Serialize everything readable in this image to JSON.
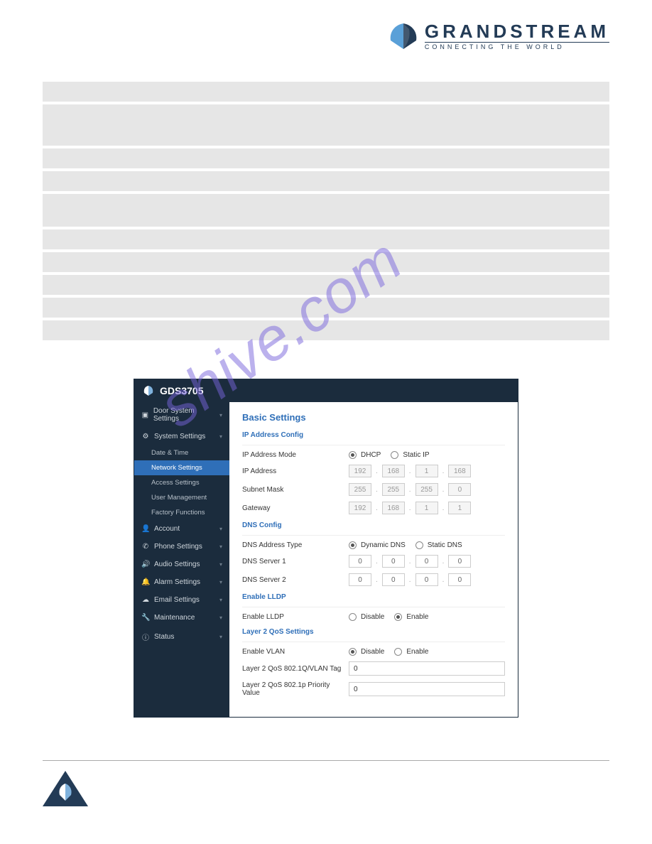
{
  "brand": {
    "name": "GRANDSTREAM",
    "tagline": "CONNECTING THE WORLD"
  },
  "settings_rows": [
    {
      "label": "",
      "desc": "",
      "h": "h-small"
    },
    {
      "label": "",
      "desc": "",
      "h": "h-med"
    },
    {
      "label": "",
      "desc": "",
      "h": "h-small"
    },
    {
      "label": "",
      "desc": "",
      "h": "h-small"
    },
    {
      "label": "",
      "desc": "",
      "h": "h-tall"
    },
    {
      "label": "",
      "desc": "",
      "h": "h-small"
    },
    {
      "label": "",
      "desc": "",
      "h": "h-small"
    },
    {
      "label": "",
      "desc": "",
      "h": "h-small"
    },
    {
      "label": "",
      "desc": "",
      "h": "h-small"
    },
    {
      "label": "",
      "desc": "",
      "h": "h-small"
    }
  ],
  "section": {
    "heading": "",
    "desc": ""
  },
  "watermark": "shive.com",
  "panel": {
    "title": "GDS3705",
    "sidebar": {
      "door": {
        "label": "Door System Settings"
      },
      "system": {
        "label": "System Settings",
        "children": {
          "datetime": "Date & Time",
          "network": "Network Settings",
          "access": "Access Settings",
          "usermgmt": "User Management",
          "factory": "Factory Functions"
        }
      },
      "account": {
        "label": "Account"
      },
      "phone": {
        "label": "Phone Settings"
      },
      "audio": {
        "label": "Audio Settings"
      },
      "alarm": {
        "label": "Alarm Settings"
      },
      "email": {
        "label": "Email Settings"
      },
      "maint": {
        "label": "Maintenance"
      },
      "status": {
        "label": "Status"
      }
    },
    "content": {
      "page_title": "Basic Settings",
      "ip_config": {
        "title": "IP Address Config",
        "mode_label": "IP Address Mode",
        "mode_dhcp": "DHCP",
        "mode_static": "Static IP",
        "ip_label": "IP Address",
        "ip": [
          "192",
          "168",
          "1",
          "168"
        ],
        "subnet_label": "Subnet Mask",
        "subnet": [
          "255",
          "255",
          "255",
          "0"
        ],
        "gw_label": "Gateway",
        "gw": [
          "192",
          "168",
          "1",
          "1"
        ]
      },
      "dns": {
        "title": "DNS Config",
        "type_label": "DNS Address Type",
        "type_dyn": "Dynamic DNS",
        "type_static": "Static DNS",
        "s1_label": "DNS Server 1",
        "s1": [
          "0",
          "0",
          "0",
          "0"
        ],
        "s2_label": "DNS Server 2",
        "s2": [
          "0",
          "0",
          "0",
          "0"
        ]
      },
      "lldp": {
        "title": "Enable LLDP",
        "label": "Enable LLDP",
        "disable": "Disable",
        "enable": "Enable"
      },
      "qos": {
        "title": "Layer 2 QoS Settings",
        "vlan_label": "Enable VLAN",
        "disable": "Disable",
        "enable": "Enable",
        "tag_label": "Layer 2 QoS 802.1Q/VLAN Tag",
        "tag_value": "0",
        "prio_label": "Layer 2 QoS 802.1p Priority Value",
        "prio_value": "0"
      }
    }
  },
  "figure_caption": ""
}
